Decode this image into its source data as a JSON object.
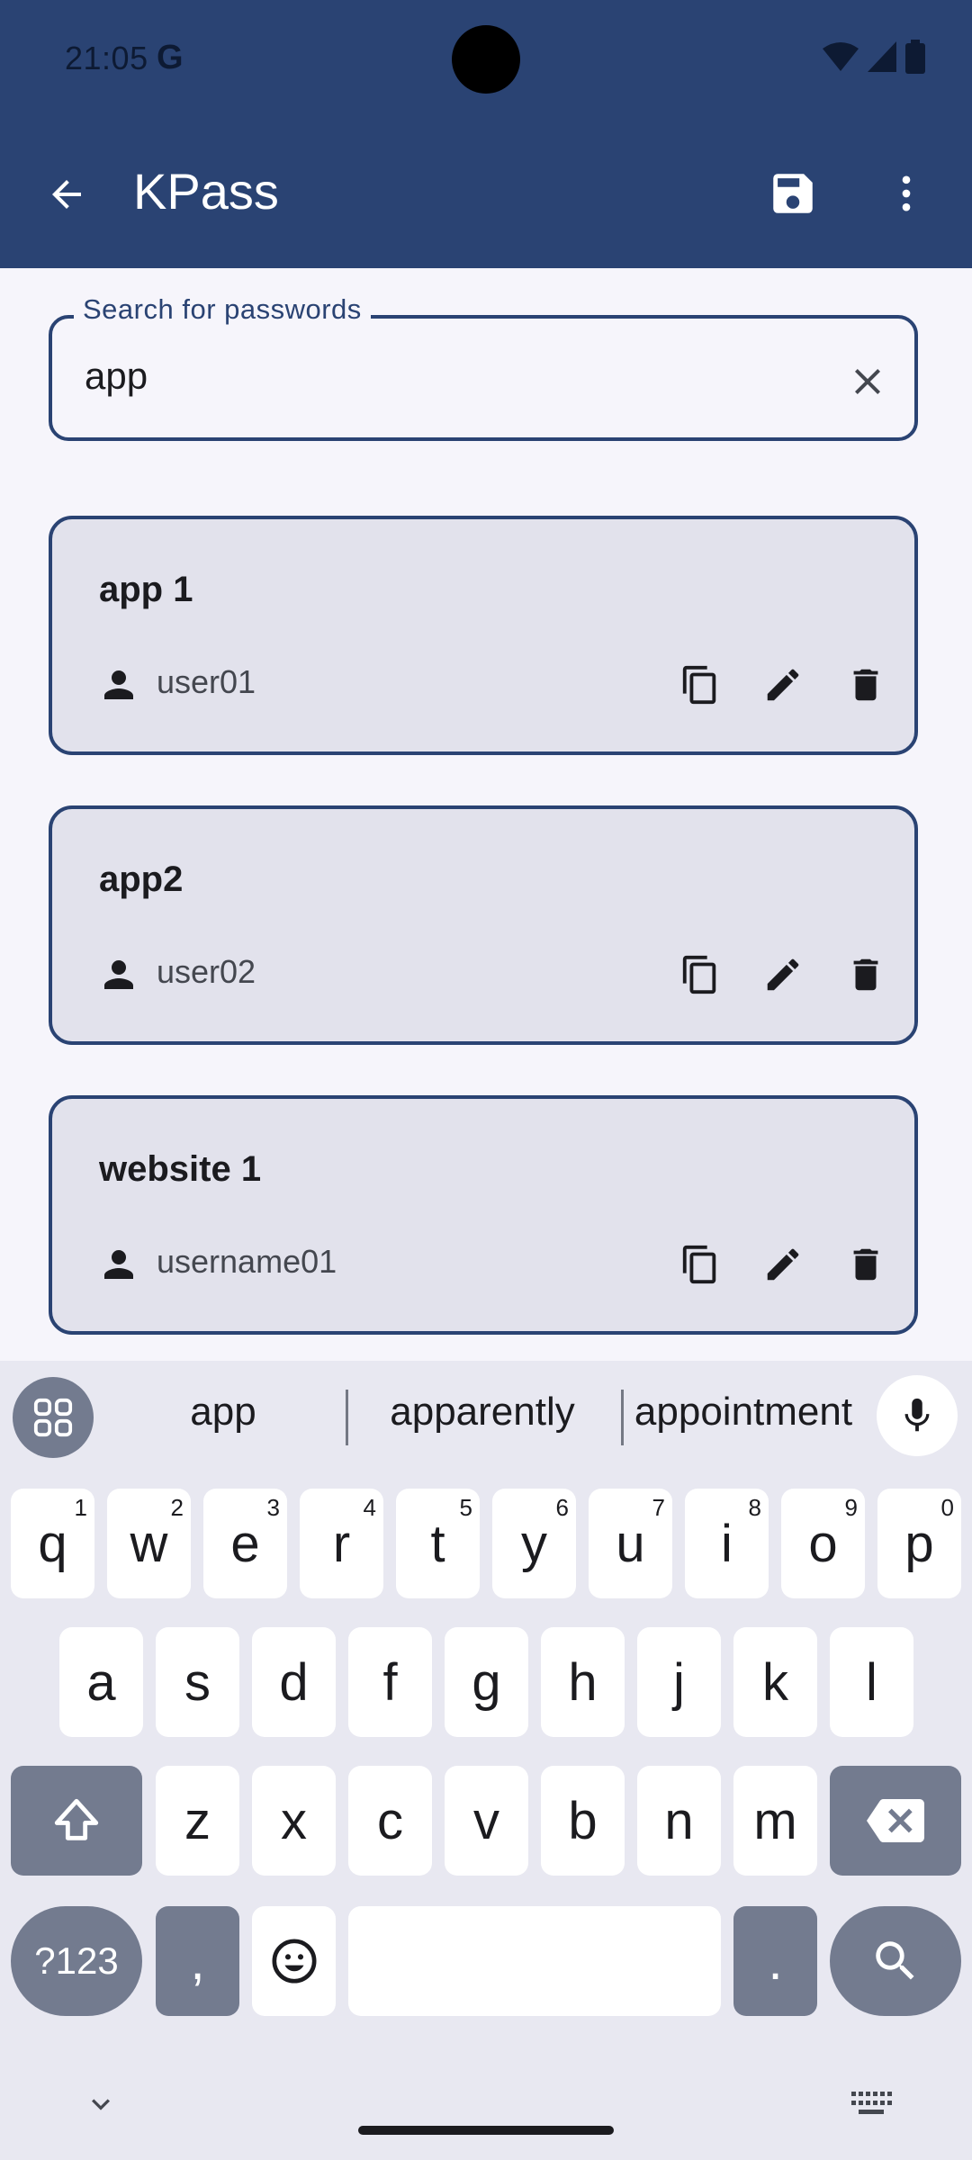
{
  "status_bar": {
    "time": "21:05",
    "google_glyph": "G",
    "icons": [
      "wifi-icon",
      "signal-icon",
      "battery-icon"
    ]
  },
  "app_bar": {
    "title": "KPass",
    "back_icon": "arrow-back-icon",
    "save_icon": "save-icon",
    "menu_icon": "more-vert-icon"
  },
  "search": {
    "label": "Search for passwords",
    "value": "app",
    "clear_icon": "close-icon"
  },
  "entries": [
    {
      "title": "app 1",
      "username": "user01"
    },
    {
      "title": "app2",
      "username": "user02"
    },
    {
      "title": "website 1",
      "username": "username01"
    }
  ],
  "keyboard": {
    "suggestions": [
      "app",
      "apparently",
      "appointment"
    ],
    "row1": [
      {
        "key": "q",
        "hint": "1"
      },
      {
        "key": "w",
        "hint": "2"
      },
      {
        "key": "e",
        "hint": "3"
      },
      {
        "key": "r",
        "hint": "4"
      },
      {
        "key": "t",
        "hint": "5"
      },
      {
        "key": "y",
        "hint": "6"
      },
      {
        "key": "u",
        "hint": "7"
      },
      {
        "key": "i",
        "hint": "8"
      },
      {
        "key": "o",
        "hint": "9"
      },
      {
        "key": "p",
        "hint": "0"
      }
    ],
    "row2": [
      "a",
      "s",
      "d",
      "f",
      "g",
      "h",
      "j",
      "k",
      "l"
    ],
    "row3": [
      "z",
      "x",
      "c",
      "v",
      "b",
      "n",
      "m"
    ],
    "symbols_key": "?123",
    "comma_key": ",",
    "period_key": "."
  },
  "colors": {
    "primary": "#2a4373",
    "card_bg": "#e2e2ec",
    "page_bg": "#f6f5fb",
    "keyboard_bg": "#e8e8f1",
    "key_dark": "#737b8f"
  }
}
